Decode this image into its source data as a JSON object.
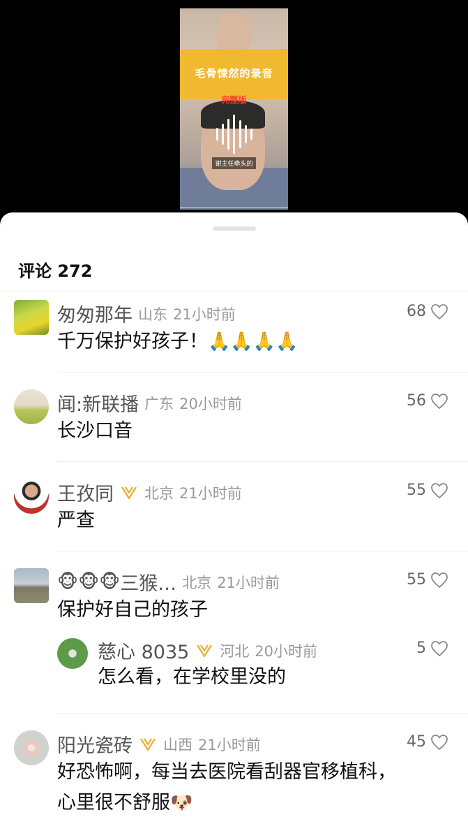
{
  "video": {
    "banner": "毛骨悚然的录音",
    "subtitle": "完整版",
    "caption": "谢主任牵头的"
  },
  "comments_header": "评论 272",
  "comments": [
    {
      "name": "匆匆那年",
      "location": "山东",
      "time": "21小时前",
      "likes": "68",
      "text": "千万保护好孩子！",
      "emojis": "🙏🙏🙏🙏",
      "avatar": "rapeseed-field",
      "badge": false
    },
    {
      "name": "闻:新联播",
      "location": "广东",
      "time": "20小时前",
      "likes": "56",
      "text": "长沙口音",
      "avatar": "child-photo",
      "badge": false
    },
    {
      "name": "王孜同",
      "location": "北京",
      "time": "21小时前",
      "likes": "55",
      "text": "严查",
      "avatar": "person-photo",
      "badge": true
    },
    {
      "name_prefix": "🐵🐵🐵",
      "name": "三猴…",
      "location": "北京",
      "time": "21小时前",
      "likes": "55",
      "text": "保护好自己的孩子",
      "avatar": "lake-landscape",
      "badge": false,
      "reply": {
        "name": "慈心 8035",
        "location": "河北",
        "time": "20小时前",
        "likes": "5",
        "text": "怎么看，在学校里没的",
        "avatar": "lotus-leaf",
        "badge": true
      }
    },
    {
      "name": "阳光瓷砖",
      "location": "山西",
      "time": "21小时前",
      "likes": "45",
      "text_line1": "好恐怖啊，每当去医院看刮器官移植科，",
      "text_line2": "心里很不舒服",
      "emoji_end": "🐶",
      "avatar": "flower",
      "badge": true
    }
  ],
  "colors": {
    "badge_gold": "#e8b33c",
    "name_gray": "#555555",
    "meta_gray": "#999999"
  }
}
